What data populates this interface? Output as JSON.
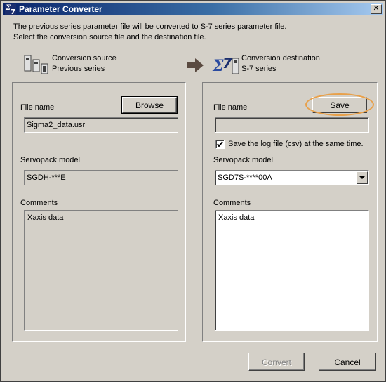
{
  "window": {
    "title": "Parameter Converter",
    "close_glyph": "✕",
    "icon": "sigma7-icon"
  },
  "intro": {
    "line1": "The previous series parameter file will be converted to S-7 series parameter file.",
    "line2": "Select the conversion source file and the destination file."
  },
  "source": {
    "heading_line1": "Conversion source",
    "heading_line2": "Previous series",
    "icon": "servopack-drives-icon",
    "file_name_label": "File name",
    "browse_label": "Browse",
    "file_name_value": "Sigma2_data.usr",
    "servopack_label": "Servopack model",
    "servopack_value": "SGDH-***E",
    "comments_label": "Comments",
    "comments_value": "Xaxis data"
  },
  "arrow_icon": "right-arrow-icon",
  "destination": {
    "heading_line1": "Conversion destination",
    "heading_line2": "S-7 series",
    "icon": "sigma7-drive-icon",
    "file_name_label": "File name",
    "save_label": "Save",
    "file_name_value": "",
    "save_log_label": "Save the log file (csv) at the same time.",
    "save_log_checked": true,
    "servopack_label": "Servopack model",
    "servopack_value": "SGD7S-****00A",
    "comments_label": "Comments",
    "comments_value": "Xaxis data"
  },
  "footer": {
    "convert_label": "Convert",
    "cancel_label": "Cancel"
  },
  "colors": {
    "title_gradient_start": "#0a246a",
    "title_gradient_end": "#a6caf0",
    "highlight": "#e8a04a",
    "face": "#d4d0c8"
  }
}
